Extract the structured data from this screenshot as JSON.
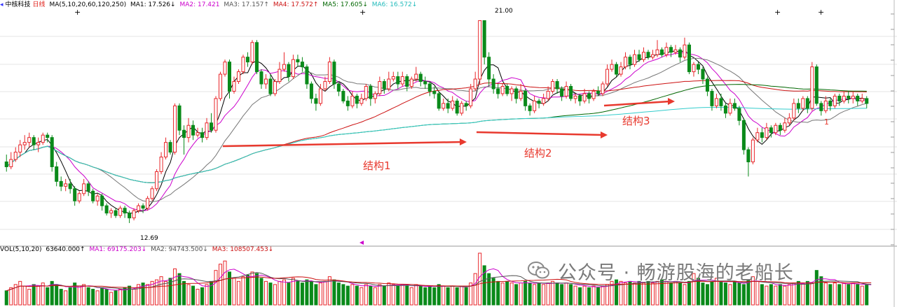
{
  "header": {
    "stock_name": "中核科技",
    "period": "日线",
    "ma_params": "MA(5,10,20,60,120,250)",
    "ma1": "MA1: 17.526↓",
    "ma2": "MA2: 17.421",
    "ma3": "MA3: 17.157↑",
    "ma4": "MA4: 17.572↑",
    "ma5": "MA5: 17.605↓",
    "ma6": "MA6: 16.572↓",
    "colors": {
      "ma1": "#000000",
      "ma2": "#cc00cc",
      "ma3": "#777777",
      "ma4": "#cc1111",
      "ma5": "#006600",
      "ma6": "#33cccc"
    }
  },
  "volume_header": {
    "params": "VOL(5,10,20)",
    "vol": "63640.000↑",
    "ma1": "MA1: 69175.203↓",
    "ma2": "MA2: 94743.500↓",
    "ma3": "MA3: 108507.453↓"
  },
  "annotations": {
    "high_label": "21.00",
    "low_label": "12.69",
    "structure1": "结构1",
    "structure2": "结构2",
    "structure3": "结构3",
    "callout_1": "1",
    "annotation_color": "#e8392e"
  },
  "watermark": {
    "text": "公众号 · 畅游股海的老船长",
    "icon": "wechat-icon"
  },
  "chart_data": {
    "type": "candlestick",
    "price_range": [
      12.0,
      21.5
    ],
    "candles": [
      [
        15.2,
        15.0,
        15.5,
        14.8
      ],
      [
        15.0,
        15.3,
        15.6,
        14.9
      ],
      [
        15.3,
        15.6,
        15.8,
        15.2
      ],
      [
        15.6,
        15.9,
        16.1,
        15.4
      ],
      [
        15.9,
        16.0,
        16.3,
        15.7
      ],
      [
        16.0,
        16.2,
        16.4,
        15.8
      ],
      [
        16.2,
        15.9,
        16.3,
        15.7
      ],
      [
        15.9,
        16.0,
        16.2,
        15.6
      ],
      [
        16.0,
        16.3,
        16.4,
        15.9
      ],
      [
        16.3,
        16.2,
        16.4,
        16.0
      ],
      [
        16.2,
        15.0,
        16.3,
        14.8
      ],
      [
        15.0,
        14.4,
        15.2,
        14.2
      ],
      [
        14.4,
        14.2,
        14.6,
        14.0
      ],
      [
        14.2,
        14.3,
        14.5,
        14.0
      ],
      [
        14.3,
        14.1,
        14.5,
        13.9
      ],
      [
        14.1,
        13.6,
        14.2,
        13.4
      ],
      [
        13.6,
        13.9,
        14.0,
        13.5
      ],
      [
        13.9,
        14.3,
        14.5,
        13.8
      ],
      [
        14.3,
        14.0,
        14.4,
        13.8
      ],
      [
        14.0,
        13.6,
        14.1,
        13.5
      ],
      [
        13.6,
        13.8,
        13.9,
        13.4
      ],
      [
        13.8,
        13.4,
        13.9,
        13.2
      ],
      [
        13.4,
        13.1,
        13.5,
        13.0
      ],
      [
        13.1,
        13.2,
        13.3,
        12.9
      ],
      [
        13.2,
        13.0,
        13.3,
        12.9
      ],
      [
        13.0,
        13.3,
        13.4,
        12.9
      ],
      [
        13.3,
        13.1,
        13.4,
        12.9
      ],
      [
        13.1,
        12.9,
        13.2,
        12.69
      ],
      [
        12.9,
        13.2,
        13.3,
        12.8
      ],
      [
        13.2,
        13.4,
        13.5,
        13.1
      ],
      [
        13.4,
        13.3,
        13.5,
        13.1
      ],
      [
        13.3,
        13.7,
        13.8,
        13.2
      ],
      [
        13.7,
        14.1,
        14.2,
        13.6
      ],
      [
        14.1,
        14.8,
        14.9,
        14.0
      ],
      [
        14.8,
        15.4,
        15.6,
        14.7
      ],
      [
        15.4,
        16.0,
        16.2,
        15.3
      ],
      [
        16.0,
        15.6,
        16.1,
        15.5
      ],
      [
        15.6,
        17.5,
        17.6,
        15.5
      ],
      [
        17.5,
        16.5,
        17.6,
        16.3
      ],
      [
        16.5,
        16.2,
        16.7,
        15.5
      ],
      [
        16.2,
        16.7,
        17.0,
        16.0
      ],
      [
        16.7,
        16.3,
        16.9,
        16.1
      ],
      [
        16.3,
        16.4,
        16.6,
        16.2
      ],
      [
        16.4,
        16.2,
        16.6,
        16.0
      ],
      [
        16.2,
        16.8,
        17.0,
        16.1
      ],
      [
        16.8,
        16.5,
        17.2,
        16.4
      ],
      [
        16.5,
        17.8,
        17.9,
        16.4
      ],
      [
        17.8,
        18.8,
        18.9,
        17.7
      ],
      [
        18.8,
        19.3,
        19.4,
        18.7
      ],
      [
        19.3,
        18.1,
        19.4,
        17.8
      ],
      [
        18.1,
        18.5,
        18.7,
        18.0
      ],
      [
        18.5,
        18.9,
        19.0,
        18.4
      ],
      [
        18.9,
        19.5,
        19.6,
        18.8
      ],
      [
        19.5,
        19.3,
        19.7,
        19.1
      ],
      [
        19.3,
        20.1,
        20.2,
        19.2
      ],
      [
        20.1,
        18.9,
        20.2,
        18.8
      ],
      [
        18.9,
        18.4,
        19.0,
        18.2
      ],
      [
        18.4,
        18.6,
        18.8,
        18.2
      ],
      [
        18.6,
        18.0,
        18.8,
        17.9
      ],
      [
        18.0,
        18.5,
        18.6,
        17.9
      ],
      [
        18.5,
        19.0,
        19.3,
        18.4
      ],
      [
        19.0,
        19.2,
        19.7,
        18.9
      ],
      [
        19.2,
        18.7,
        19.3,
        18.5
      ],
      [
        18.7,
        19.4,
        19.6,
        18.6
      ],
      [
        19.4,
        19.3,
        19.6,
        19.1
      ],
      [
        19.3,
        19.1,
        19.5,
        18.9
      ],
      [
        19.1,
        18.4,
        19.2,
        18.2
      ],
      [
        18.4,
        17.8,
        18.5,
        17.6
      ],
      [
        17.8,
        17.6,
        18.0,
        17.3
      ],
      [
        17.6,
        18.2,
        18.4,
        17.5
      ],
      [
        18.2,
        18.5,
        18.7,
        18.1
      ],
      [
        18.5,
        19.3,
        19.5,
        18.4
      ],
      [
        19.3,
        18.4,
        19.4,
        18.2
      ],
      [
        18.4,
        18.1,
        18.5,
        17.9
      ],
      [
        18.1,
        17.7,
        18.2,
        17.6
      ],
      [
        17.7,
        17.5,
        17.9,
        17.3
      ],
      [
        17.5,
        17.9,
        18.1,
        17.4
      ],
      [
        17.9,
        17.6,
        18.0,
        17.4
      ],
      [
        17.6,
        17.8,
        18.0,
        17.5
      ],
      [
        17.8,
        18.3,
        18.4,
        17.7
      ],
      [
        18.3,
        17.8,
        18.4,
        17.5
      ],
      [
        17.8,
        18.0,
        18.1,
        17.6
      ],
      [
        18.0,
        18.5,
        18.7,
        17.9
      ],
      [
        18.5,
        18.2,
        18.6,
        18.0
      ],
      [
        18.2,
        18.6,
        18.9,
        18.1
      ],
      [
        18.6,
        18.7,
        18.9,
        18.5
      ],
      [
        18.7,
        18.4,
        18.9,
        18.2
      ],
      [
        18.4,
        18.7,
        18.9,
        18.3
      ],
      [
        18.7,
        18.3,
        18.8,
        18.1
      ],
      [
        18.3,
        18.6,
        18.7,
        18.2
      ],
      [
        18.6,
        18.8,
        19.1,
        18.5
      ],
      [
        18.8,
        18.5,
        18.9,
        18.3
      ],
      [
        18.5,
        18.4,
        18.7,
        18.2
      ],
      [
        18.4,
        18.1,
        18.5,
        17.9
      ],
      [
        18.1,
        18.0,
        18.3,
        17.8
      ],
      [
        18.0,
        17.4,
        18.1,
        17.3
      ],
      [
        17.4,
        17.6,
        17.8,
        17.3
      ],
      [
        17.6,
        17.4,
        17.8,
        17.2
      ],
      [
        17.4,
        17.7,
        17.9,
        17.3
      ],
      [
        17.7,
        17.2,
        17.8,
        17.1
      ],
      [
        17.2,
        17.6,
        17.7,
        17.1
      ],
      [
        17.6,
        17.5,
        17.7,
        17.3
      ],
      [
        17.5,
        18.2,
        18.4,
        17.4
      ],
      [
        18.2,
        18.6,
        18.9,
        18.1
      ],
      [
        18.6,
        21.0,
        21.0,
        18.4
      ],
      [
        21.0,
        19.5,
        21.0,
        19.2
      ],
      [
        19.5,
        18.6,
        19.7,
        18.3
      ],
      [
        18.6,
        18.2,
        18.8,
        18.0
      ],
      [
        18.2,
        18.0,
        18.4,
        17.8
      ],
      [
        18.0,
        18.3,
        18.4,
        17.9
      ],
      [
        18.3,
        18.0,
        18.4,
        17.9
      ],
      [
        18.0,
        18.2,
        18.3,
        17.7
      ],
      [
        18.2,
        17.8,
        18.3,
        17.6
      ],
      [
        17.8,
        18.1,
        18.4,
        17.7
      ],
      [
        18.1,
        17.5,
        18.2,
        17.3
      ],
      [
        17.5,
        17.3,
        17.6,
        17.1
      ],
      [
        17.3,
        17.7,
        17.9,
        17.2
      ],
      [
        17.7,
        17.6,
        17.8,
        17.4
      ],
      [
        17.6,
        17.8,
        18.0,
        17.5
      ],
      [
        17.8,
        18.1,
        18.3,
        17.7
      ],
      [
        18.1,
        18.5,
        18.6,
        18.0
      ],
      [
        18.5,
        18.2,
        18.6,
        18.0
      ],
      [
        18.2,
        17.9,
        18.3,
        17.7
      ],
      [
        17.9,
        18.3,
        18.5,
        17.8
      ],
      [
        18.3,
        17.8,
        18.4,
        17.7
      ],
      [
        17.8,
        17.9,
        18.0,
        17.6
      ],
      [
        17.9,
        17.7,
        18.0,
        17.5
      ],
      [
        17.7,
        18.0,
        18.2,
        17.6
      ],
      [
        18.0,
        17.8,
        18.1,
        17.6
      ],
      [
        17.8,
        18.1,
        18.2,
        17.7
      ],
      [
        18.1,
        18.0,
        18.3,
        17.9
      ],
      [
        18.0,
        18.4,
        18.5,
        17.9
      ],
      [
        18.4,
        19.0,
        19.2,
        18.3
      ],
      [
        19.0,
        19.2,
        19.4,
        18.9
      ],
      [
        19.2,
        18.8,
        19.3,
        18.7
      ],
      [
        18.8,
        19.1,
        19.3,
        18.7
      ],
      [
        19.1,
        19.5,
        19.7,
        19.0
      ],
      [
        19.5,
        19.2,
        19.6,
        19.0
      ],
      [
        19.2,
        19.6,
        19.8,
        19.1
      ],
      [
        19.6,
        19.4,
        19.8,
        19.3
      ],
      [
        19.4,
        19.7,
        19.9,
        19.3
      ],
      [
        19.7,
        19.5,
        19.8,
        19.4
      ],
      [
        19.5,
        19.6,
        19.8,
        19.4
      ],
      [
        19.6,
        19.8,
        20.2,
        19.5
      ],
      [
        19.8,
        19.6,
        19.9,
        19.5
      ],
      [
        19.6,
        19.9,
        20.1,
        19.5
      ],
      [
        19.9,
        19.7,
        20.0,
        19.5
      ],
      [
        19.7,
        19.8,
        20.0,
        19.6
      ],
      [
        19.8,
        19.5,
        19.9,
        19.3
      ],
      [
        19.5,
        20.0,
        20.3,
        19.4
      ],
      [
        20.0,
        18.9,
        20.1,
        18.8
      ],
      [
        18.9,
        19.2,
        19.3,
        18.7
      ],
      [
        19.2,
        19.0,
        19.3,
        18.8
      ],
      [
        19.0,
        18.6,
        19.1,
        18.4
      ],
      [
        18.6,
        18.1,
        18.7,
        17.9
      ],
      [
        18.1,
        17.5,
        18.2,
        17.3
      ],
      [
        17.5,
        17.8,
        18.0,
        17.4
      ],
      [
        17.8,
        17.5,
        18.0,
        17.3
      ],
      [
        17.5,
        17.2,
        17.6,
        17.0
      ],
      [
        17.2,
        17.6,
        17.8,
        17.1
      ],
      [
        17.6,
        17.4,
        17.8,
        17.3
      ],
      [
        17.4,
        16.9,
        17.5,
        16.7
      ],
      [
        16.9,
        15.7,
        17.0,
        15.5
      ],
      [
        15.7,
        15.2,
        15.8,
        14.6
      ],
      [
        15.2,
        16.1,
        16.2,
        15.1
      ],
      [
        16.1,
        16.4,
        16.6,
        16.0
      ],
      [
        16.4,
        16.2,
        16.6,
        16.0
      ],
      [
        16.2,
        16.6,
        16.8,
        16.1
      ],
      [
        16.6,
        16.4,
        16.7,
        16.2
      ],
      [
        16.4,
        16.7,
        16.8,
        16.3
      ],
      [
        16.7,
        16.5,
        16.8,
        16.3
      ],
      [
        16.5,
        16.8,
        17.0,
        16.4
      ],
      [
        16.8,
        17.0,
        17.2,
        16.7
      ],
      [
        17.0,
        17.6,
        17.8,
        16.9
      ],
      [
        17.6,
        17.4,
        17.8,
        17.2
      ],
      [
        17.4,
        17.8,
        17.9,
        17.3
      ],
      [
        17.8,
        17.4,
        17.9,
        17.2
      ],
      [
        17.4,
        19.1,
        19.3,
        17.3
      ],
      [
        19.1,
        17.6,
        19.2,
        17.5
      ],
      [
        17.6,
        17.3,
        17.7,
        17.1
      ],
      [
        17.3,
        17.7,
        17.9,
        17.2
      ],
      [
        17.7,
        17.5,
        17.8,
        17.3
      ],
      [
        17.5,
        17.9,
        18.0,
        17.4
      ],
      [
        17.9,
        17.7,
        18.0,
        17.5
      ],
      [
        17.7,
        17.9,
        18.1,
        17.6
      ],
      [
        17.9,
        17.8,
        18.1,
        17.6
      ],
      [
        17.8,
        17.9,
        18.1,
        17.6
      ],
      [
        17.9,
        17.7,
        18.0,
        17.5
      ],
      [
        17.7,
        17.8,
        18.0,
        17.6
      ],
      [
        17.8,
        17.6,
        17.9,
        17.4
      ]
    ],
    "volumes": [
      18,
      22,
      26,
      30,
      24,
      20,
      26,
      24,
      28,
      22,
      30,
      26,
      20,
      18,
      22,
      28,
      24,
      26,
      22,
      20,
      18,
      22,
      20,
      16,
      18,
      20,
      22,
      24,
      20,
      26,
      28,
      26,
      30,
      32,
      36,
      30,
      34,
      46,
      40,
      30,
      26,
      24,
      20,
      22,
      26,
      30,
      44,
      52,
      56,
      42,
      34,
      30,
      36,
      38,
      42,
      40,
      34,
      30,
      28,
      26,
      30,
      32,
      28,
      34,
      30,
      28,
      32,
      30,
      26,
      28,
      30,
      36,
      32,
      28,
      26,
      24,
      26,
      24,
      22,
      26,
      24,
      22,
      26,
      24,
      28,
      26,
      24,
      26,
      24,
      22,
      26,
      24,
      22,
      24,
      22,
      26,
      24,
      22,
      24,
      22,
      24,
      22,
      28,
      40,
      66,
      50,
      40,
      34,
      30,
      28,
      30,
      28,
      26,
      28,
      30,
      28,
      26,
      28,
      26,
      28,
      30,
      28,
      26,
      28,
      26,
      24,
      22,
      24,
      22,
      24,
      22,
      24,
      26,
      30,
      32,
      30,
      28,
      30,
      28,
      30,
      28,
      30,
      28,
      30,
      32,
      30,
      28,
      30,
      28,
      26,
      30,
      40,
      34,
      28,
      26,
      30,
      34,
      30,
      28,
      26,
      30,
      28,
      26,
      32,
      36,
      30,
      26,
      24,
      26,
      24,
      26,
      24,
      26,
      28,
      30,
      28,
      30,
      28,
      44,
      36,
      28,
      26,
      28,
      26,
      28,
      26,
      28,
      26,
      24,
      26,
      24
    ]
  }
}
